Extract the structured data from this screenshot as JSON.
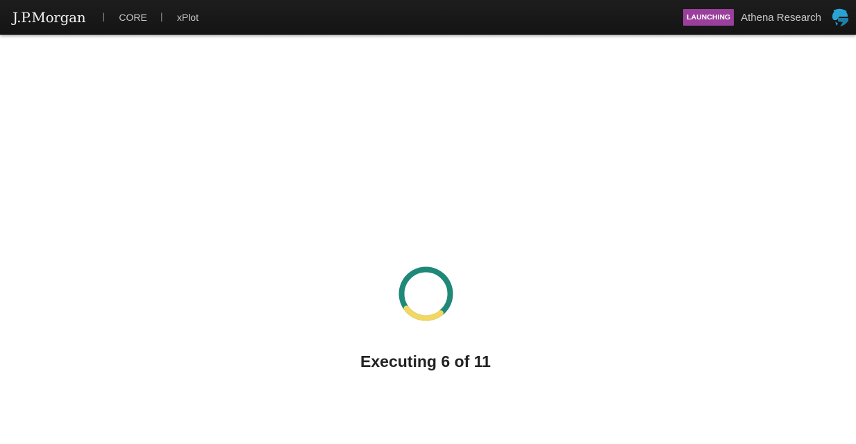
{
  "header": {
    "brand": "J.P.Morgan",
    "nav": [
      {
        "label": "CORE"
      },
      {
        "label": "xPlot"
      }
    ],
    "separator": "|",
    "status_badge": "LAUNCHING",
    "app_name": "Athena Research",
    "app_icon": "athena-helmet-icon"
  },
  "loading": {
    "icon": "spinner-icon",
    "status_text": "Executing 6 of 11",
    "progress": {
      "current": 6,
      "total": 11
    }
  },
  "colors": {
    "topbar": "#181818",
    "badge": "#9b3f9d",
    "spinner_track": "#1f8878",
    "spinner_arc": "#f2d760",
    "athena_icon": "#2aa3d4"
  }
}
